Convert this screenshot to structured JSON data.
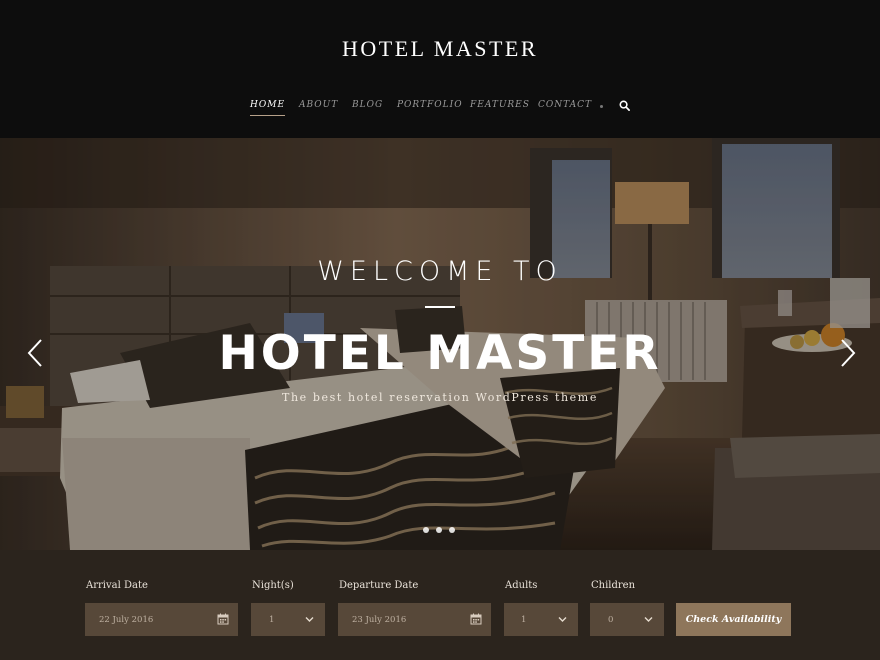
{
  "header": {
    "logo": "HOTEL MASTER",
    "nav": [
      {
        "label": "HOME",
        "active": true
      },
      {
        "label": "ABOUT",
        "active": false
      },
      {
        "label": "BLOG",
        "active": false
      },
      {
        "label": "PORTFOLIO",
        "active": false
      },
      {
        "label": "FEATURES",
        "active": false
      },
      {
        "label": "CONTACT",
        "active": false
      }
    ],
    "search_icon": "search-icon"
  },
  "hero": {
    "welcome": "WELCOME TO",
    "title": "HOTEL MASTER",
    "subtitle": "The best hotel reservation WordPress theme",
    "slide_count": 3,
    "active_slide": 1
  },
  "booking": {
    "arrival": {
      "label": "Arrival Date",
      "value": "22 July 2016"
    },
    "nights": {
      "label": "Night(s)",
      "value": "1"
    },
    "departure": {
      "label": "Departure Date",
      "value": "23 July 2016"
    },
    "adults": {
      "label": "Adults",
      "value": "1"
    },
    "children": {
      "label": "Children",
      "value": "0"
    },
    "button": "Check Availability"
  },
  "colors": {
    "header_bg": "#0d0d0d",
    "booking_bg": "#2b241d",
    "field_bg": "#574839",
    "button_bg": "#8e765b"
  }
}
